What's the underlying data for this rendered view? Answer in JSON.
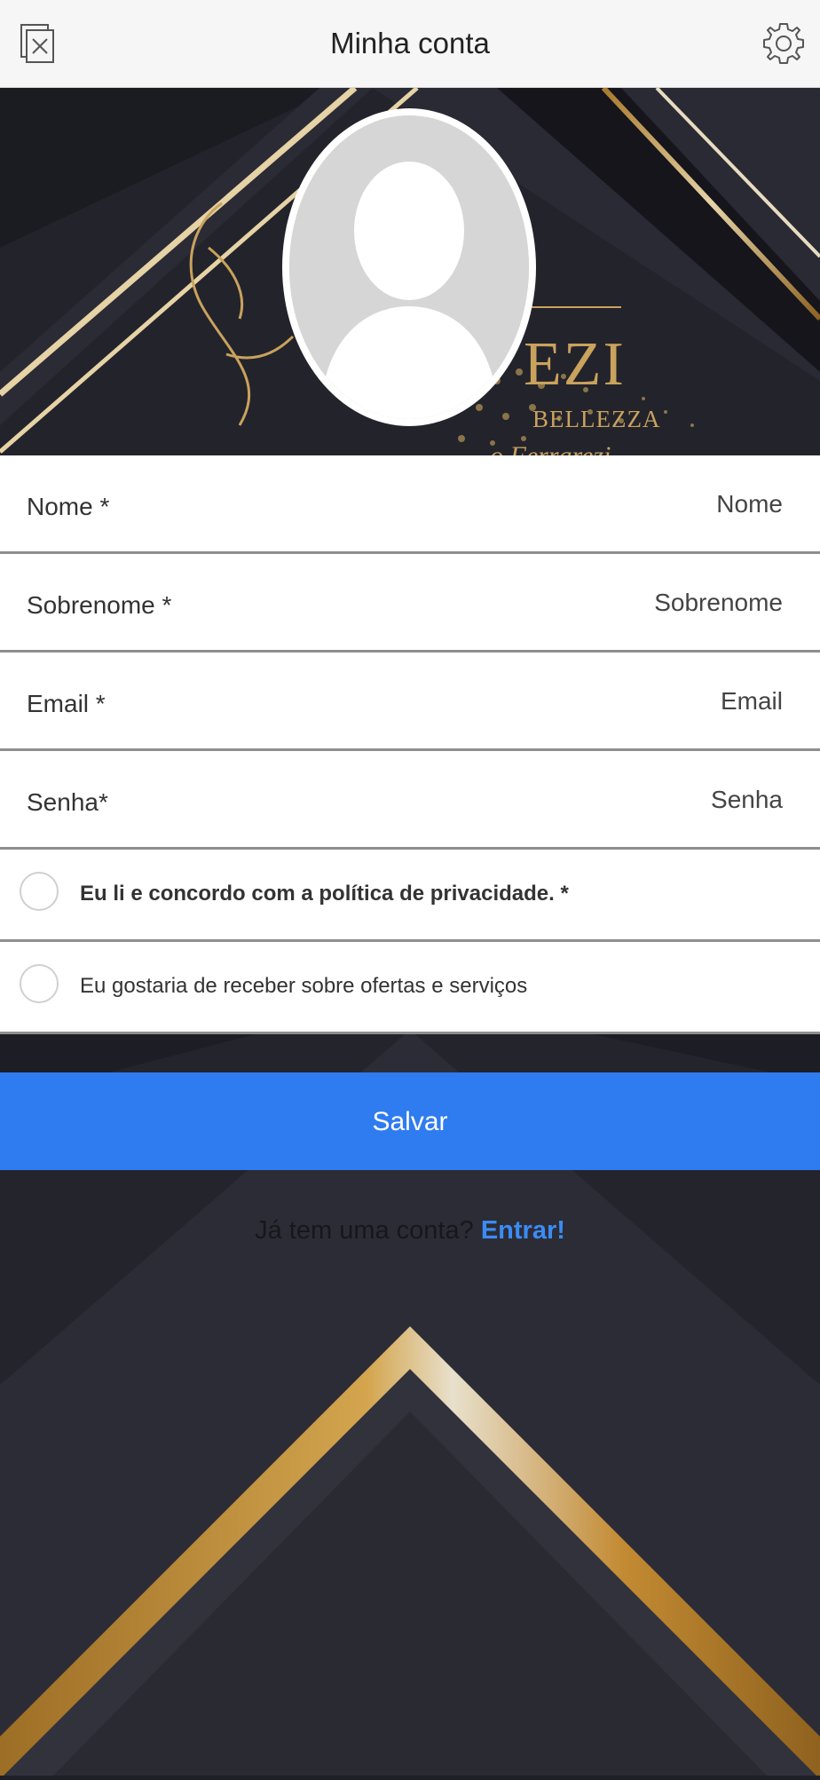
{
  "header": {
    "title": "Minha conta",
    "left_icon": "close-window-icon",
    "right_icon": "gear-icon"
  },
  "banner": {
    "brand_line1": "EZI",
    "brand_line2": "BELLEZZA",
    "brand_line3": "o Ferrarezi"
  },
  "form": {
    "fields": [
      {
        "label": "Nome *",
        "placeholder": "Nome"
      },
      {
        "label": "Sobrenome *",
        "placeholder": "Sobrenome"
      },
      {
        "label": "Email *",
        "placeholder": "Email"
      },
      {
        "label": "Senha*",
        "placeholder": "Senha"
      }
    ],
    "privacy": "Eu li e concordo com a política de privacidade. *",
    "offers": "Eu gostaria de receber sobre ofertas e serviços"
  },
  "actions": {
    "save_label": "Salvar",
    "login_question": "Já tem uma conta?",
    "login_link": "Entrar!"
  },
  "colors": {
    "accent": "#2f7bf0",
    "link": "#3a8cf5",
    "gold": "#c9a25c",
    "dark_bg": "#1f1f27"
  }
}
